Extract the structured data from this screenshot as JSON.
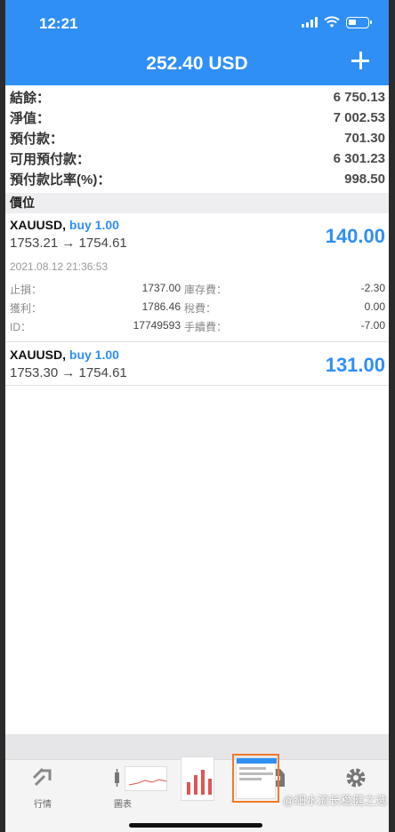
{
  "status_bar": {
    "time": "12:21"
  },
  "header": {
    "title": "252.40 USD"
  },
  "summary": [
    {
      "label": "結餘：",
      "value": "6 750.13"
    },
    {
      "label": "淨值：",
      "value": "7 002.53"
    },
    {
      "label": "預付款：",
      "value": "701.30"
    },
    {
      "label": "可用預付款：",
      "value": "6 301.23"
    },
    {
      "label": "預付款比率(%)：",
      "value": "998.50"
    }
  ],
  "positions_header": "價位",
  "positions": [
    {
      "symbol": "XAUUSD,",
      "side": "buy 1.00",
      "prices": "1753.21 → 1754.61",
      "profit": "140.00",
      "time": "2021.08.12 21:36:53",
      "details": {
        "sl_label": "止損：",
        "sl_value": "1737.00",
        "swap_label": "庫存費：",
        "swap_value": "-2.30",
        "tp_label": "獲利：",
        "tp_value": "1786.46",
        "tax_label": "稅費：",
        "tax_value": "0.00",
        "id_label": "ID：",
        "id_value": "17749593",
        "fee_label": "手續費：",
        "fee_value": "-7.00"
      }
    },
    {
      "symbol": "XAUUSD,",
      "side": "buy 1.00",
      "prices": "1753.30 → 1754.61",
      "profit": "131.00"
    }
  ],
  "tabbar": {
    "quotes": "行情",
    "charts": "圖表"
  },
  "watermark": "@細水流长稳健之选",
  "colors": {
    "accent": "#2f8ff5",
    "profit": "#2f8ff5",
    "thumb_frame": "#f07a2a"
  },
  "icons": [
    "signal-icon",
    "wifi-icon",
    "battery-icon",
    "plus-icon",
    "quotes-icon",
    "candlestick-icon",
    "mailbox-icon",
    "gear-icon"
  ]
}
